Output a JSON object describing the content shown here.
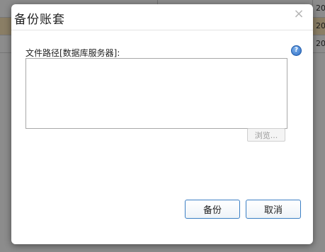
{
  "background": {
    "cells": [
      "20",
      "20",
      "20"
    ]
  },
  "dialog": {
    "title": "备份账套",
    "close_glyph": "×",
    "path_label": "文件路径[数据库服务器]:",
    "path_value": "",
    "help_glyph": "?",
    "browse_label": "浏览...",
    "backup_label": "备份",
    "cancel_label": "取消"
  },
  "icons": {
    "close": "close-icon",
    "help": "help-icon"
  },
  "colors": {
    "button_border": "#3b7fc4",
    "highlight_row": "#fbe6b8",
    "help_blue": "#2c6cc4"
  }
}
